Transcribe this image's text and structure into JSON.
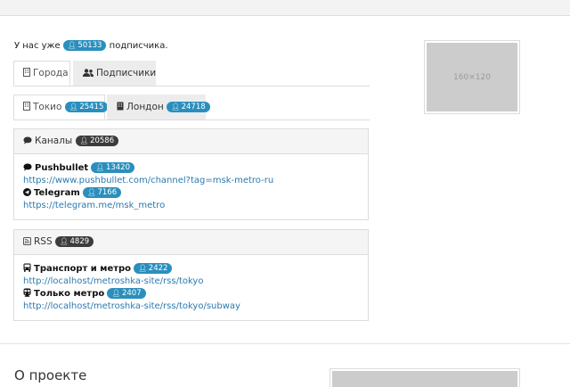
{
  "subscribers": {
    "prefix": "У нас уже",
    "count": "50133",
    "suffix": "подписчика."
  },
  "tabs": [
    {
      "label": "Города",
      "active": true
    },
    {
      "label": "Подписчики",
      "active": false
    }
  ],
  "city_tabs": [
    {
      "label": "Токио",
      "count": "25415",
      "active": true
    },
    {
      "label": "Лондон",
      "count": "24718",
      "active": false
    }
  ],
  "channels": {
    "title": "Каналы",
    "count": "20586",
    "items": [
      {
        "name": "Pushbullet",
        "count": "13420",
        "url": "https://www.pushbullet.com/channel?tag=msk-metro-ru",
        "icon": "comment-icon"
      },
      {
        "name": "Telegram",
        "count": "7166",
        "url": "https://telegram.me/msk_metro",
        "icon": "telegram-icon"
      }
    ]
  },
  "rss": {
    "title": "RSS",
    "count": "4829",
    "items": [
      {
        "name": "Транспорт и метро",
        "count": "2422",
        "url": "http://localhost/metroshka-site/rss/tokyo",
        "icon": "bus-icon"
      },
      {
        "name": "Только метро",
        "count": "2407",
        "url": "http://localhost/metroshka-site/rss/tokyo/subway",
        "icon": "train-icon"
      }
    ]
  },
  "ad": {
    "label": "160×120"
  },
  "about": {
    "title": "О проекте"
  },
  "colors": {
    "badge": "#2a8fbd",
    "badge_dark": "#3c3c3c",
    "link": "#2a7ab0"
  }
}
